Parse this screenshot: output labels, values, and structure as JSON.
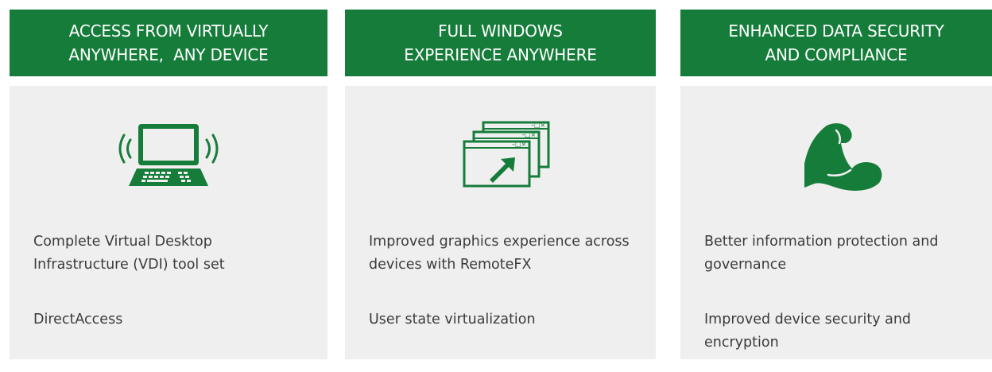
{
  "colors": {
    "green": "#157c3a",
    "panel": "#efefef",
    "text": "#3b3b3b"
  },
  "columns": [
    {
      "heading": [
        "ACCESS FROM VIRTUALLY",
        "ANYWHERE,  ANY DEVICE"
      ],
      "icon": "wireless-laptop-icon",
      "items": [
        "Complete Virtual Desktop Infrastructure (VDI) tool set",
        "DirectAccess"
      ]
    },
    {
      "heading": [
        "FULL WINDOWS",
        "EXPERIENCE ANYWHERE"
      ],
      "icon": "stacked-windows-icon",
      "items": [
        "Improved graphics experience across devices with RemoteFX",
        "User state virtualization"
      ]
    },
    {
      "heading": [
        "ENHANCED DATA SECURITY",
        "AND COMPLIANCE"
      ],
      "icon": "flexed-arm-icon",
      "items": [
        "Better information protection and governance",
        "Improved device security and encryption"
      ]
    }
  ]
}
